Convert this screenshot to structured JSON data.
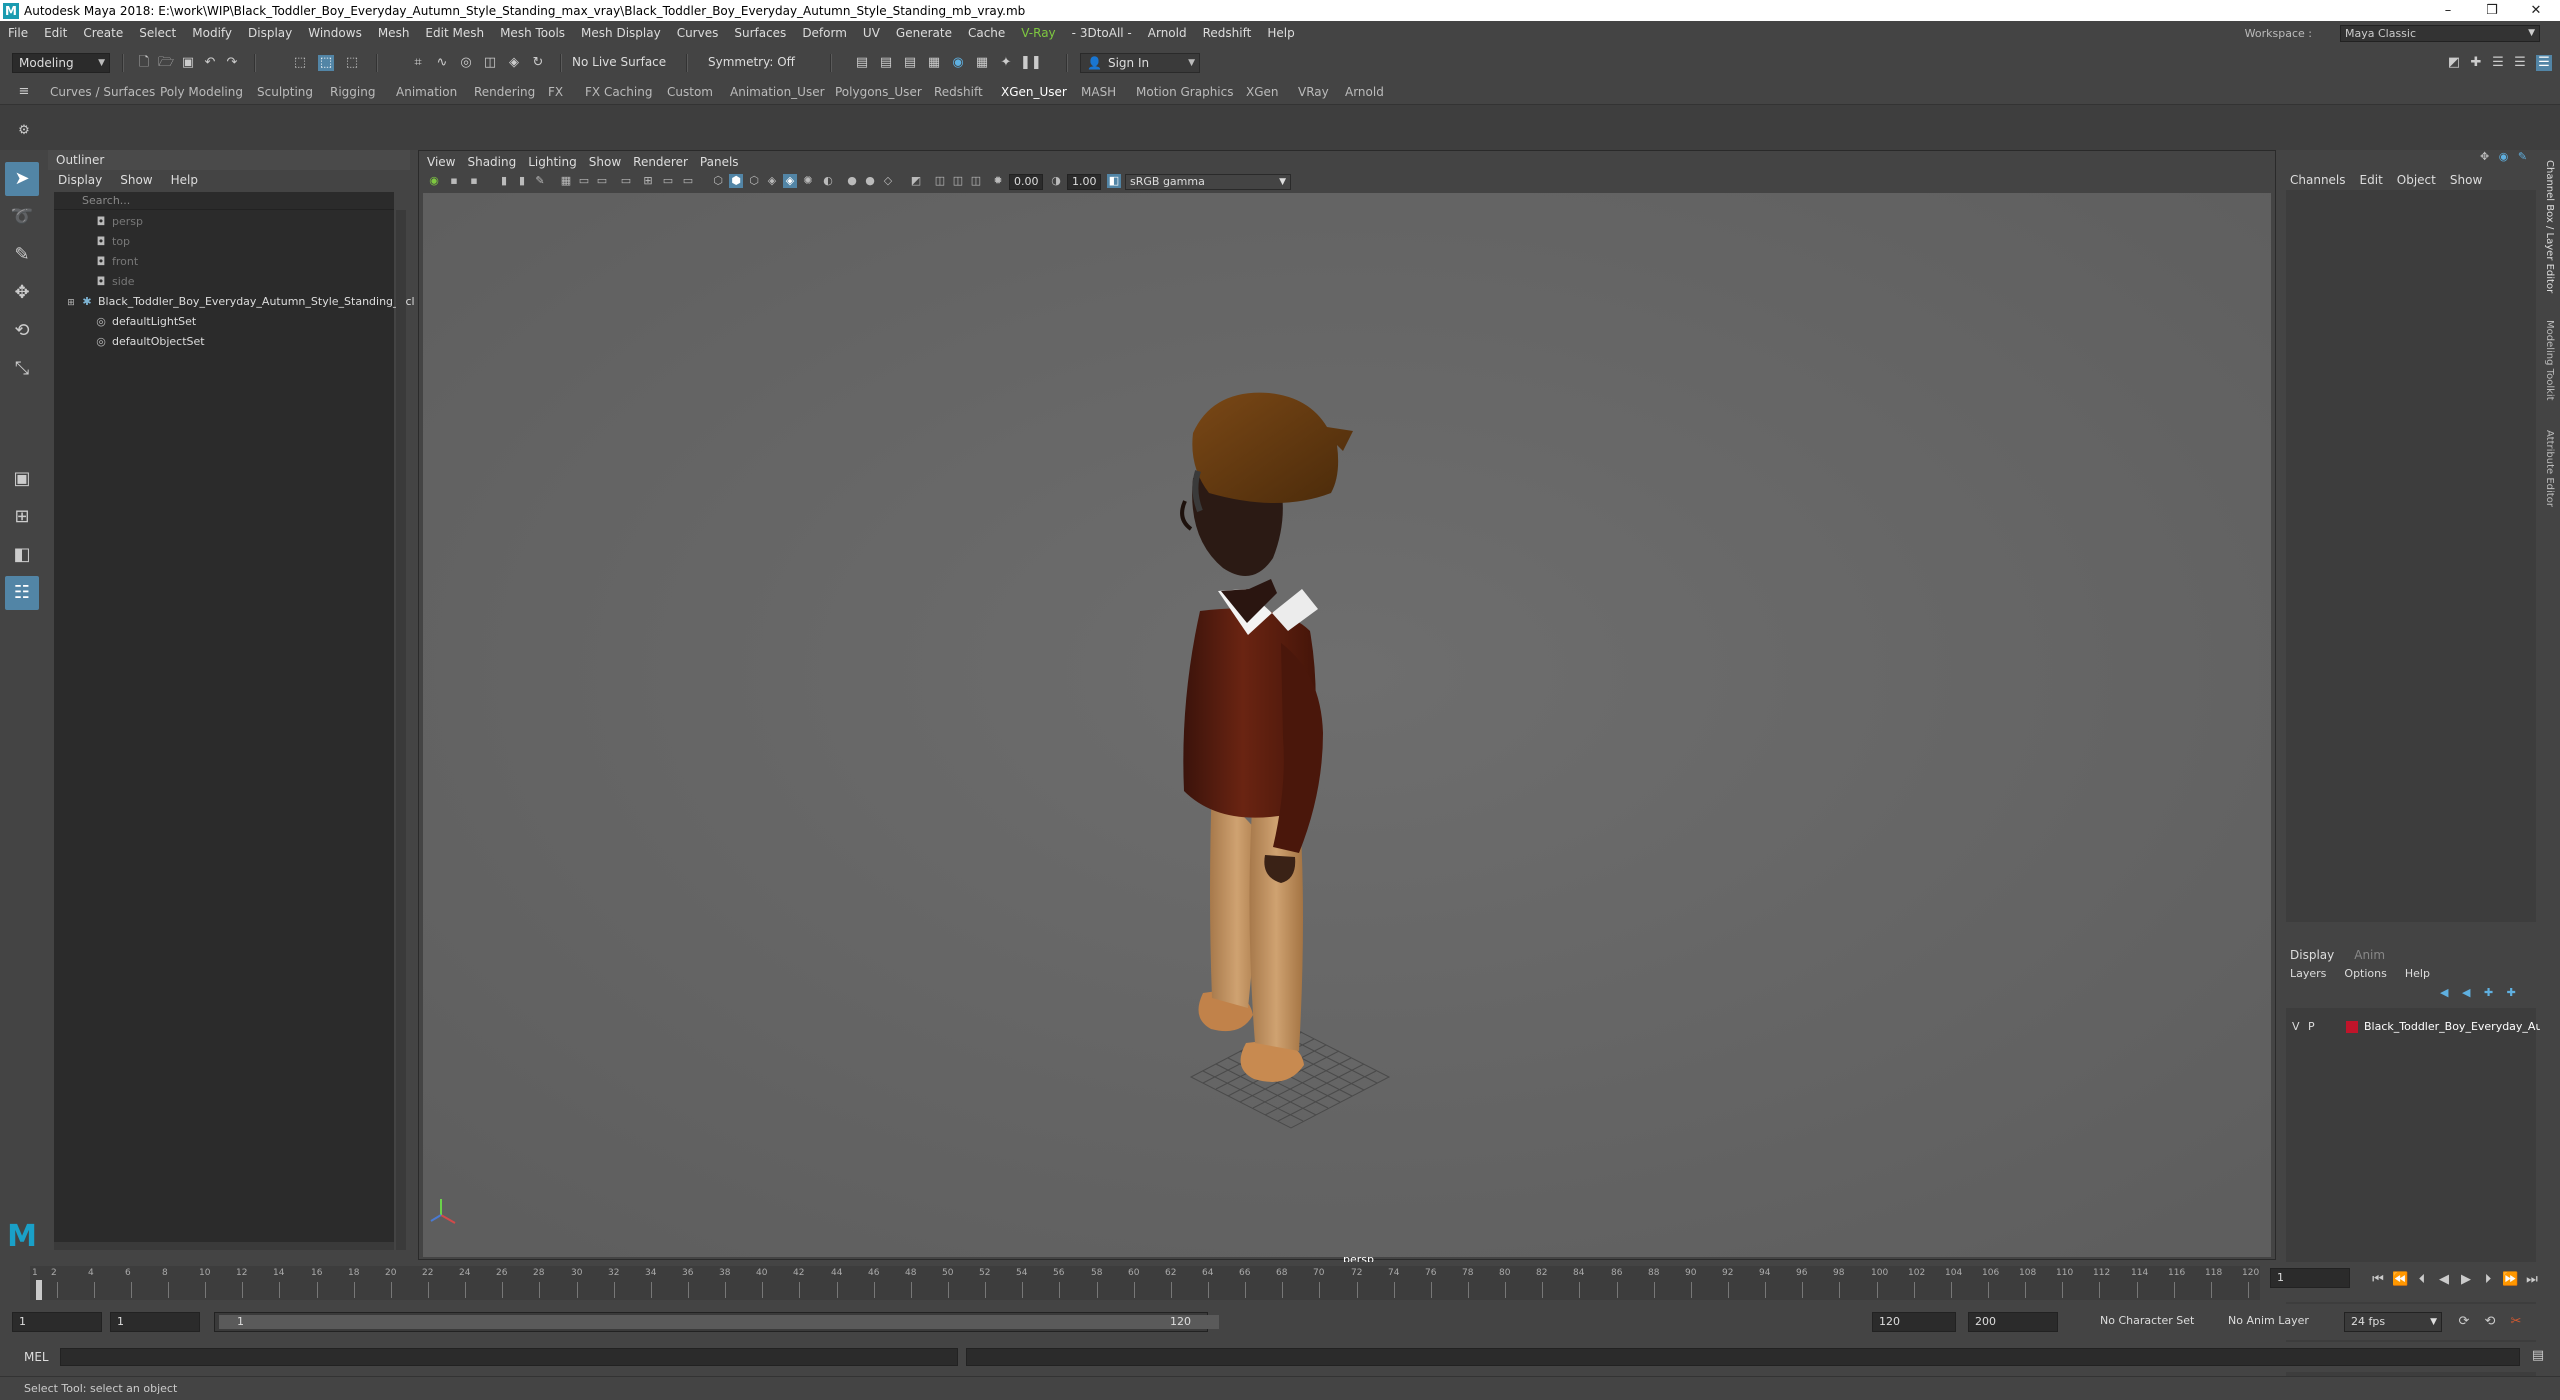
{
  "titlebar": {
    "title": "Autodesk Maya 2018: E:\\work\\WIP\\Black_Toddler_Boy_Everyday_Autumn_Style_Standing_max_vray\\Black_Toddler_Boy_Everyday_Autumn_Style_Standing_mb_vray.mb",
    "minimize": "–",
    "restore": "❒",
    "close": "✕"
  },
  "menubar": {
    "items": [
      "File",
      "Edit",
      "Create",
      "Select",
      "Modify",
      "Display",
      "Windows",
      "Mesh",
      "Edit Mesh",
      "Mesh Tools",
      "Mesh Display",
      "Curves",
      "Surfaces",
      "Deform",
      "UV",
      "Generate",
      "Cache",
      "V-Ray",
      "- 3DtoAll -",
      "Arnold",
      "Redshift",
      "Help"
    ],
    "workspace_label": "Workspace :",
    "workspace_value": "Maya Classic"
  },
  "toolbar": {
    "mode": "Modeling",
    "live_surface": "No Live Surface",
    "symmetry": "Symmetry: Off",
    "sign_in": "Sign In"
  },
  "shelf": {
    "tabs": [
      "Curves / Surfaces",
      "Poly Modeling",
      "Sculpting",
      "Rigging",
      "Animation",
      "Rendering",
      "FX",
      "FX Caching",
      "Custom",
      "Animation_User",
      "Polygons_User",
      "Redshift",
      "XGen_User",
      "MASH",
      "Motion Graphics",
      "XGen",
      "VRay",
      "Arnold"
    ],
    "active": "XGen_User"
  },
  "outliner": {
    "title": "Outliner",
    "menu": [
      "Display",
      "Show",
      "Help"
    ],
    "search_placeholder": "Search...",
    "items": [
      {
        "label": "persp",
        "icon": "camera-icon",
        "dim": true
      },
      {
        "label": "top",
        "icon": "camera-icon",
        "dim": true
      },
      {
        "label": "front",
        "icon": "camera-icon",
        "dim": true
      },
      {
        "label": "side",
        "icon": "camera-icon",
        "dim": true
      },
      {
        "label": "Black_Toddler_Boy_Everyday_Autumn_Style_Standing_ncl",
        "icon": "mesh-icon",
        "dim": false
      },
      {
        "label": "defaultLightSet",
        "icon": "set-icon",
        "dim": false
      },
      {
        "label": "defaultObjectSet",
        "icon": "set-icon",
        "dim": false
      }
    ]
  },
  "viewport": {
    "menu": [
      "View",
      "Shading",
      "Lighting",
      "Show",
      "Renderer",
      "Panels"
    ],
    "exposure": "0.00",
    "gamma": "1.00",
    "color_space": "sRGB gamma",
    "camera_label": "persp"
  },
  "channelbox": {
    "menu": [
      "Channels",
      "Edit",
      "Object",
      "Show"
    ],
    "side_tabs": [
      "Channel Box / Layer Editor",
      "Modeling Toolkit",
      "Attribute Editor"
    ]
  },
  "layers": {
    "tabs": [
      "Display",
      "Anim"
    ],
    "menu": [
      "Layers",
      "Options",
      "Help"
    ],
    "layer": {
      "v": "V",
      "p": "P",
      "name": "Black_Toddler_Boy_Everyday_Autu",
      "color": "#c0142a"
    }
  },
  "timeline": {
    "ticks": [
      "1",
      "2",
      "4",
      "6",
      "8",
      "10",
      "12",
      "14",
      "16",
      "18",
      "20",
      "22",
      "24",
      "26",
      "28",
      "30",
      "32",
      "34",
      "36",
      "38",
      "40",
      "42",
      "44",
      "46",
      "48",
      "50",
      "52",
      "54",
      "56",
      "58",
      "60",
      "62",
      "64",
      "66",
      "68",
      "70",
      "72",
      "74",
      "76",
      "78",
      "80",
      "82",
      "84",
      "86",
      "88",
      "90",
      "92",
      "94",
      "96",
      "98",
      "100",
      "102",
      "104",
      "106",
      "108",
      "110",
      "112",
      "114",
      "116",
      "118",
      "120"
    ],
    "current_frame": "1"
  },
  "range": {
    "start": "1",
    "playback_start": "1",
    "slider_start": "1",
    "slider_end": "120",
    "playback_end": "120",
    "end": "200",
    "character_set": "No Character Set",
    "anim_layer": "No Anim Layer",
    "fps": "24 fps"
  },
  "cmdline": {
    "label": "MEL"
  },
  "status": {
    "text": "Select Tool: select an object"
  }
}
